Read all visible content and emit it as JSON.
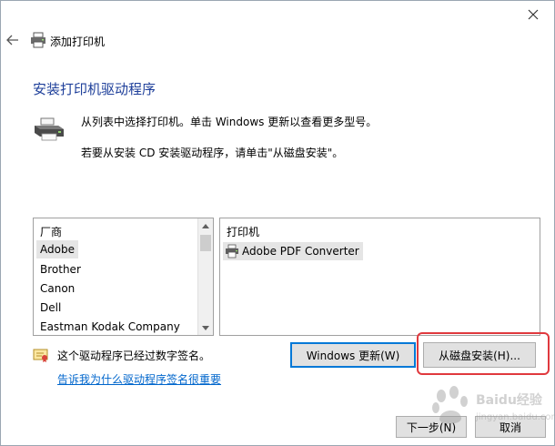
{
  "window": {
    "title": "添加打印机"
  },
  "heading": "安装打印机驱动程序",
  "description": {
    "line1": "从列表中选择打印机。单击 Windows 更新以查看更多型号。",
    "line2": "若要从安装 CD 安装驱动程序，请单击\"从磁盘安装\"。"
  },
  "manufacturer_list": {
    "header": "厂商",
    "items": [
      "Adobe",
      "Brother",
      "Canon",
      "Dell",
      "Eastman Kodak Company"
    ],
    "selected_index": 0
  },
  "printer_list": {
    "header": "打印机",
    "items": [
      "Adobe PDF Converter"
    ]
  },
  "signature": {
    "text": "这个驱动程序已经过数字签名。",
    "link": "告诉我为什么驱动程序签名很重要"
  },
  "buttons": {
    "windows_update": "Windows 更新(W)",
    "have_disk": "从磁盘安装(H)...",
    "next": "下一步(N)",
    "cancel": "取消"
  },
  "watermark": {
    "text": "Baidu经验",
    "sub": "jingyan.baidu.com"
  },
  "colors": {
    "heading": "#1e3f9a",
    "link": "#0066cc",
    "focus_border": "#0078d7",
    "highlight_border": "#e0393e"
  },
  "icons": [
    "close-icon",
    "back-arrow-icon",
    "printer-icon",
    "scroll-up-icon",
    "scroll-down-icon",
    "certificate-icon"
  ]
}
